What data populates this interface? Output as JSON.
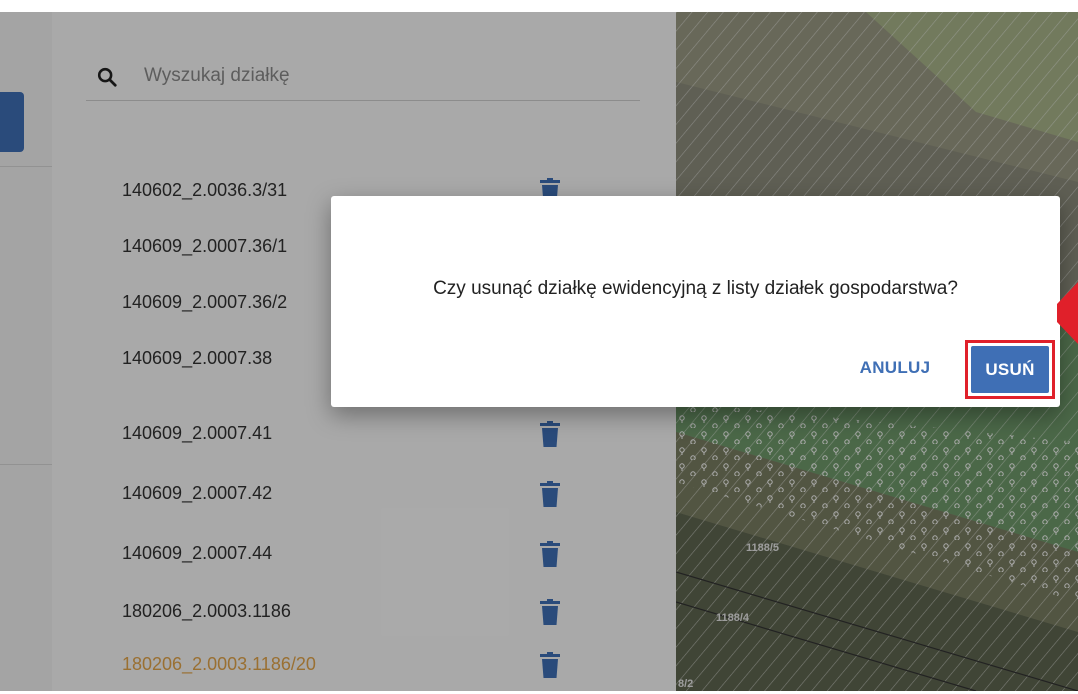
{
  "top_caption": "",
  "search": {
    "placeholder": "Wyszukaj działkę",
    "value": ""
  },
  "plots": [
    {
      "id": "140602_2.0036.3/31",
      "highlighted": false
    },
    {
      "id": "140609_2.0007.36/1",
      "highlighted": false
    },
    {
      "id": "140609_2.0007.36/2",
      "highlighted": false
    },
    {
      "id": "140609_2.0007.38",
      "highlighted": false
    },
    {
      "id": "140609_2.0007.41",
      "highlighted": false
    },
    {
      "id": "140609_2.0007.42",
      "highlighted": false
    },
    {
      "id": "140609_2.0007.44",
      "highlighted": false
    },
    {
      "id": "180206_2.0003.1186",
      "highlighted": false
    },
    {
      "id": "180206_2.0003.1186/20",
      "highlighted": true
    }
  ],
  "map": {
    "parcel_labels": [
      "1188/5",
      "1188/4",
      "8/2"
    ]
  },
  "dialog": {
    "message": "Czy usunąć działkę ewidencyjną z listy działek gospodarstwa?",
    "cancel_label": "ANULUJ",
    "confirm_label": "USUŃ"
  },
  "colors": {
    "primary": "#3f6fb5",
    "highlight_text": "#e3a54a",
    "annotation_red": "#e0202a"
  },
  "icons": {
    "search": "search-icon",
    "delete": "trash-icon"
  }
}
